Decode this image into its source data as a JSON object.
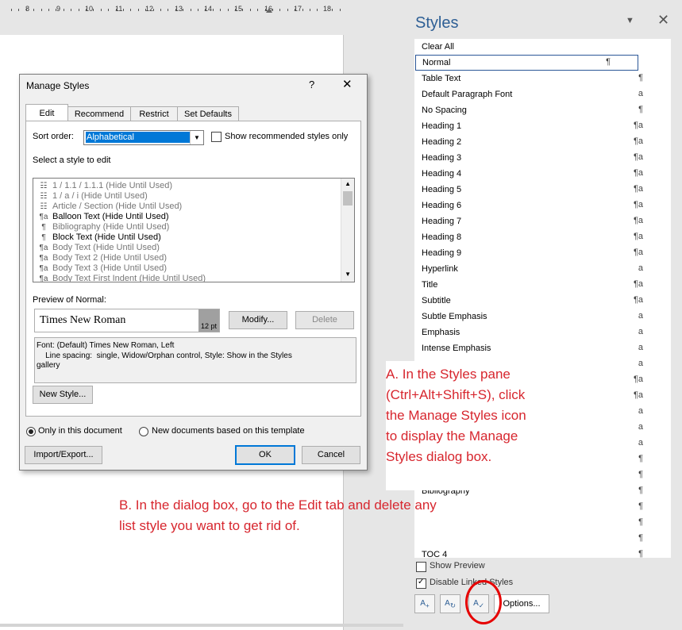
{
  "ruler": {
    "numbers": [
      "8",
      "9",
      "10",
      "11",
      "12",
      "13",
      "14",
      "15",
      "16",
      "17",
      "18"
    ]
  },
  "pane": {
    "title": "Styles",
    "menu_glyph": "▼",
    "close_glyph": "✕",
    "styles": [
      {
        "name": "Clear All",
        "glyph": ""
      },
      {
        "name": "Normal",
        "glyph": "¶"
      },
      {
        "name": "Table Text",
        "glyph": "¶"
      },
      {
        "name": "Default Paragraph Font",
        "glyph": "a"
      },
      {
        "name": "No Spacing",
        "glyph": "¶"
      },
      {
        "name": "Heading 1",
        "glyph": "¶a"
      },
      {
        "name": "Heading 2",
        "glyph": "¶a"
      },
      {
        "name": "Heading 3",
        "glyph": "¶a"
      },
      {
        "name": "Heading 4",
        "glyph": "¶a"
      },
      {
        "name": "Heading 5",
        "glyph": "¶a"
      },
      {
        "name": "Heading 6",
        "glyph": "¶a"
      },
      {
        "name": "Heading 7",
        "glyph": "¶a"
      },
      {
        "name": "Heading 8",
        "glyph": "¶a"
      },
      {
        "name": "Heading 9",
        "glyph": "¶a"
      },
      {
        "name": "Hyperlink",
        "glyph": "a"
      },
      {
        "name": "Title",
        "glyph": "¶a"
      },
      {
        "name": "Subtitle",
        "glyph": "¶a"
      },
      {
        "name": "Subtle Emphasis",
        "glyph": "a"
      },
      {
        "name": "Emphasis",
        "glyph": "a"
      },
      {
        "name": "Intense Emphasis",
        "glyph": "a"
      },
      {
        "name": "",
        "glyph": "a"
      },
      {
        "name": "",
        "glyph": "¶a"
      },
      {
        "name": "",
        "glyph": "¶a"
      },
      {
        "name": "",
        "glyph": "a"
      },
      {
        "name": "",
        "glyph": "a"
      },
      {
        "name": "",
        "glyph": "a"
      },
      {
        "name": "",
        "glyph": "¶"
      },
      {
        "name": "",
        "glyph": "¶"
      },
      {
        "name": "Bibliography",
        "glyph": "¶"
      },
      {
        "name": "",
        "glyph": "¶"
      },
      {
        "name": "",
        "glyph": "¶"
      },
      {
        "name": "",
        "glyph": "¶"
      },
      {
        "name": "TOC 4",
        "glyph": "¶"
      }
    ],
    "selected_style": "Normal",
    "show_preview_label": "Show Preview",
    "disable_linked_label": "Disable Linked Styles",
    "options_label": "Options..."
  },
  "dialog": {
    "title": "Manage Styles",
    "help": "?",
    "close": "✕",
    "tabs": [
      "Edit",
      "Recommend",
      "Restrict",
      "Set Defaults"
    ],
    "sort_label": "Sort order:",
    "sort_value": "Alphabetical",
    "show_recommended_label": "Show recommended styles only",
    "select_label": "Select a style to edit",
    "list": [
      {
        "icon": "☷",
        "text": "1 / 1.1 / 1.1.1  (Hide Until Used)",
        "dim": true
      },
      {
        "icon": "☷",
        "text": "1 / a / i  (Hide Until Used)",
        "dim": true
      },
      {
        "icon": "☷",
        "text": "Article / Section  (Hide Until Used)",
        "dim": true
      },
      {
        "icon": "¶a",
        "text": "Balloon Text  (Hide Until Used)",
        "dim": false
      },
      {
        "icon": "¶",
        "text": "Bibliography  (Hide Until Used)",
        "dim": true
      },
      {
        "icon": "¶",
        "text": "Block Text  (Hide Until Used)",
        "dim": false
      },
      {
        "icon": "¶a",
        "text": "Body Text  (Hide Until Used)",
        "dim": true
      },
      {
        "icon": "¶a",
        "text": "Body Text 2  (Hide Until Used)",
        "dim": true
      },
      {
        "icon": "¶a",
        "text": "Body Text 3  (Hide Until Used)",
        "dim": true
      },
      {
        "icon": "¶a",
        "text": "Body Text First Indent  (Hide Until Used)",
        "dim": true
      }
    ],
    "preview_label": "Preview of Normal:",
    "preview_font": "Times New Roman",
    "preview_size": "12 pt",
    "modify_label": "Modify...",
    "delete_label": "Delete",
    "description_line1": "Font: (Default) Times New Roman, Left",
    "description_line2": "    Line spacing:  single, Widow/Orphan control, Style: Show in the Styles",
    "description_line3": "gallery",
    "new_style_label": "New Style...",
    "radio_doc_label": "Only in this document",
    "radio_template_label": "New documents based on this template",
    "import_label": "Import/Export...",
    "ok_label": "OK",
    "cancel_label": "Cancel"
  },
  "notes": {
    "a_lines": [
      "A. In the Styles pane",
      "(Ctrl+Alt+Shift+S), click",
      "the Manage Styles icon",
      "to display the Manage",
      "Styles dialog box."
    ],
    "b_lines": [
      "B. In the dialog box, go to the Edit tab and delete any",
      "list style you want to get rid of."
    ]
  }
}
